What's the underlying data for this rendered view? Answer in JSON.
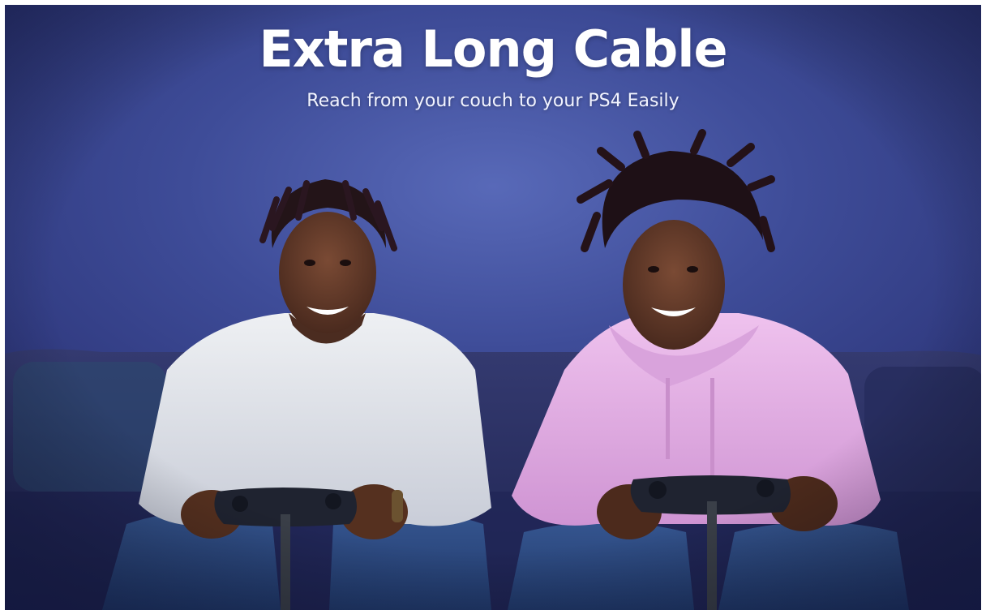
{
  "banner": {
    "title": "Extra Long Cable",
    "subtitle": "Reach from your couch to your PS4 Easily"
  },
  "scene": {
    "wall_color": "#4a5aa8",
    "couch_color": "#2b3164",
    "left_person_top_color": "#e6e8ec",
    "right_person_top_color": "#e9b6e6",
    "jeans_color": "#2f4e86",
    "controller_color": "#1f2330"
  }
}
